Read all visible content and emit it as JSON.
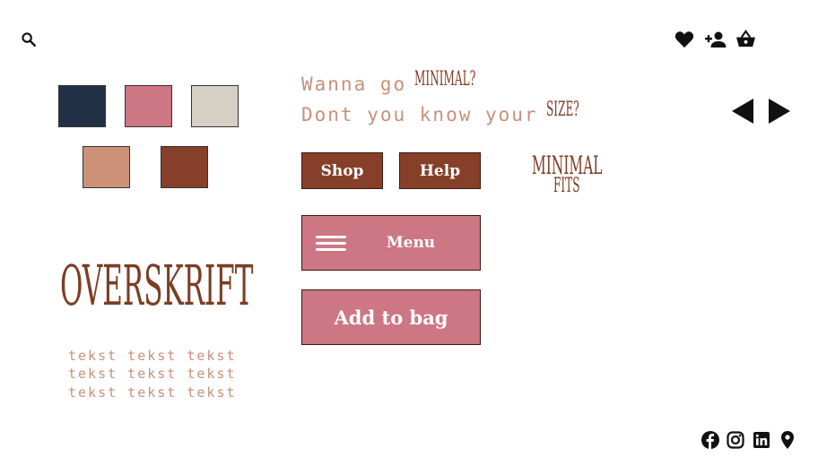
{
  "header": {
    "icons": [
      "search-icon",
      "heart-icon",
      "add-user-icon",
      "basket-icon"
    ]
  },
  "palette": {
    "swatches": [
      {
        "name": "navy",
        "color": "#223046"
      },
      {
        "name": "pink",
        "color": "#cd7684"
      },
      {
        "name": "beige",
        "color": "#d6cfc3"
      },
      {
        "name": "tan",
        "color": "#cd9178"
      },
      {
        "name": "brown",
        "color": "#86402a"
      }
    ]
  },
  "tagline": {
    "line1_prefix": "Wanna go",
    "line1_word": "MINIMAL?",
    "line2_prefix": "Dont you know your",
    "line2_word": "SIZE?"
  },
  "buttons": {
    "shop": "Shop",
    "help": "Help",
    "menu": "Menu",
    "add_to_bag": "Add to bag"
  },
  "logo": {
    "line1": "MINIMAL",
    "line2": "FITS"
  },
  "heading": {
    "title": "OVERSKRIFT"
  },
  "body_text": {
    "line1": "tekst tekst tekst",
    "line2": "tekst tekst tekst",
    "line3": "tekst tekst tekst"
  },
  "footer": {
    "icons": [
      "facebook-icon",
      "instagram-icon",
      "linkedin-icon",
      "location-pin-icon"
    ]
  },
  "colors": {
    "accent_brown": "#86402a",
    "accent_pink": "#cd7684",
    "text_tan": "#c9907a"
  }
}
